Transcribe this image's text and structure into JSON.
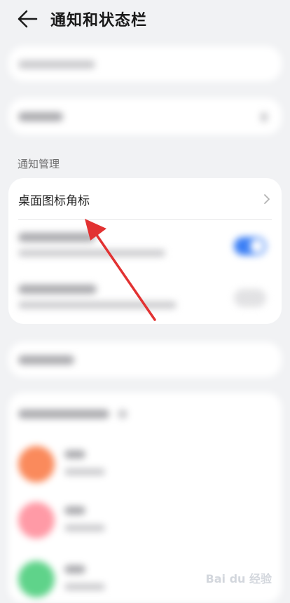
{
  "header": {
    "title": "通知和状态栏"
  },
  "section": {
    "label": "通知管理"
  },
  "rows": {
    "desktop_badge": "桌面图标角标"
  },
  "colors": {
    "accent": "#3b7ff5",
    "arrow": "#e23232"
  },
  "apps": [
    {
      "icon_color": "#fa8a5c"
    },
    {
      "icon_color": "#ff9aa6"
    },
    {
      "icon_color": "#5fd38a"
    }
  ]
}
